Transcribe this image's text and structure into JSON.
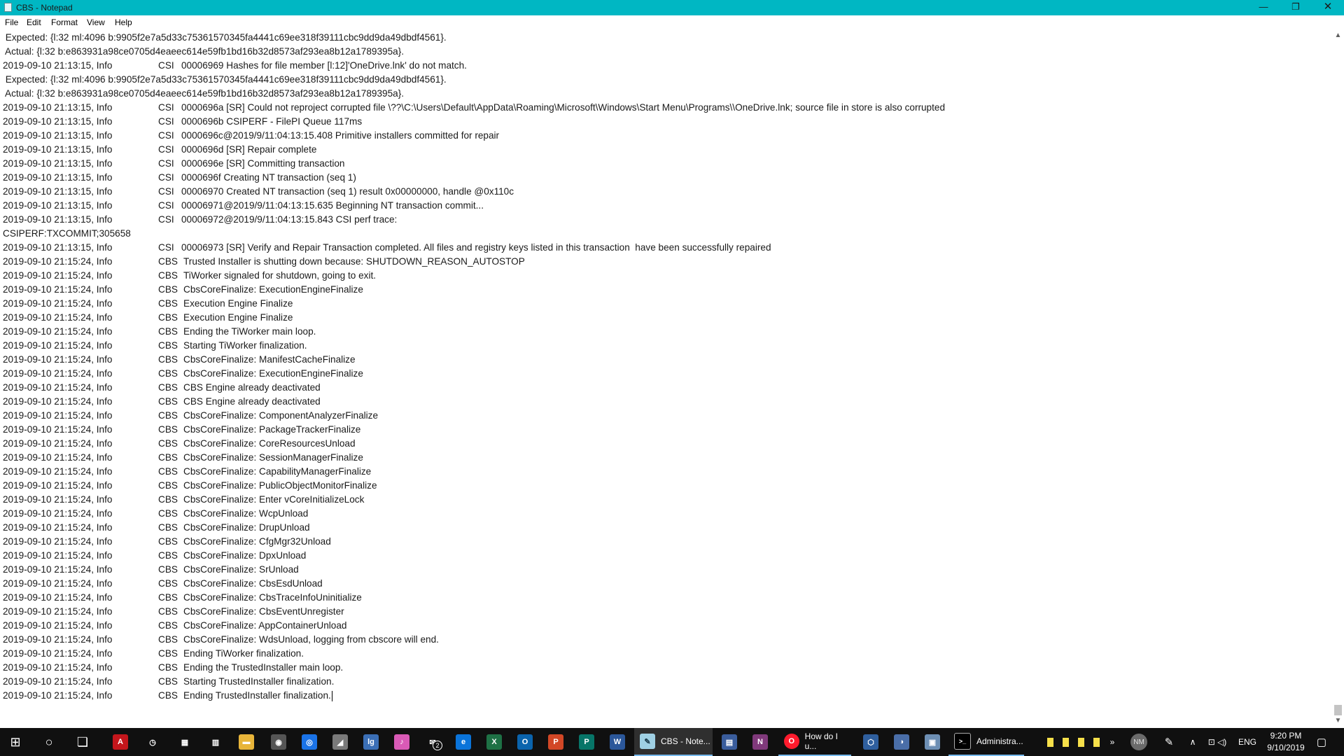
{
  "window": {
    "title": "CBS - Notepad",
    "minimize_glyph": "—",
    "maximize_glyph": "❐",
    "close_glyph": "✕"
  },
  "menu": [
    "File",
    "Edit",
    "Format",
    "View",
    "Help"
  ],
  "log": {
    "raw_lines": [
      " Expected: {l:32 ml:4096 b:9905f2e7a5d33c75361570345fa4441c69ee318f39111cbc9dd9da49dbdf4561}.",
      " Actual: {l:32 b:e863931a98ce0705d4eaeec614e59fb1bd16b32d8573af293ea8b12a1789395a}."
    ],
    "entries": [
      {
        "kind": "raw",
        "text": " Expected: {l:32 ml:4096 b:9905f2e7a5d33c75361570345fa4441c69ee318f39111cbc9dd9da49dbdf4561}."
      },
      {
        "kind": "raw",
        "text": " Actual: {l:32 b:e863931a98ce0705d4eaeec614e59fb1bd16b32d8573af293ea8b12a1789395a}."
      },
      {
        "kind": "entry",
        "ts": "2019-09-10 21:13:15, Info",
        "src": "CSI",
        "msg": "00006969 Hashes for file member [l:12]'OneDrive.lnk' do not match."
      },
      {
        "kind": "raw",
        "text": " Expected: {l:32 ml:4096 b:9905f2e7a5d33c75361570345fa4441c69ee318f39111cbc9dd9da49dbdf4561}."
      },
      {
        "kind": "raw",
        "text": " Actual: {l:32 b:e863931a98ce0705d4eaeec614e59fb1bd16b32d8573af293ea8b12a1789395a}."
      },
      {
        "kind": "entry",
        "ts": "2019-09-10 21:13:15, Info",
        "src": "CSI",
        "msg": "0000696a [SR] Could not reproject corrupted file \\??\\C:\\Users\\Default\\AppData\\Roaming\\Microsoft\\Windows\\Start Menu\\Programs\\\\OneDrive.lnk; source file in store is also corrupted"
      },
      {
        "kind": "entry",
        "ts": "2019-09-10 21:13:15, Info",
        "src": "CSI",
        "msg": "0000696b CSIPERF - FilePI Queue 117ms"
      },
      {
        "kind": "entry",
        "ts": "2019-09-10 21:13:15, Info",
        "src": "CSI",
        "msg": "0000696c@2019/9/11:04:13:15.408 Primitive installers committed for repair"
      },
      {
        "kind": "entry",
        "ts": "2019-09-10 21:13:15, Info",
        "src": "CSI",
        "msg": "0000696d [SR] Repair complete"
      },
      {
        "kind": "entry",
        "ts": "2019-09-10 21:13:15, Info",
        "src": "CSI",
        "msg": "0000696e [SR] Committing transaction"
      },
      {
        "kind": "entry",
        "ts": "2019-09-10 21:13:15, Info",
        "src": "CSI",
        "msg": "0000696f Creating NT transaction (seq 1)"
      },
      {
        "kind": "entry",
        "ts": "2019-09-10 21:13:15, Info",
        "src": "CSI",
        "msg": "00006970 Created NT transaction (seq 1) result 0x00000000, handle @0x110c"
      },
      {
        "kind": "entry",
        "ts": "2019-09-10 21:13:15, Info",
        "src": "CSI",
        "msg": "00006971@2019/9/11:04:13:15.635 Beginning NT transaction commit..."
      },
      {
        "kind": "entry",
        "ts": "2019-09-10 21:13:15, Info",
        "src": "CSI",
        "msg": "00006972@2019/9/11:04:13:15.843 CSI perf trace:"
      },
      {
        "kind": "raw",
        "text": "CSIPERF:TXCOMMIT;305658"
      },
      {
        "kind": "entry",
        "ts": "2019-09-10 21:13:15, Info",
        "src": "CSI",
        "msg": "00006973 [SR] Verify and Repair Transaction completed. All files and registry keys listed in this transaction  have been successfully repaired"
      },
      {
        "kind": "entry",
        "ts": "2019-09-10 21:15:24, Info",
        "src": "CBS",
        "msg": "Trusted Installer is shutting down because: SHUTDOWN_REASON_AUTOSTOP"
      },
      {
        "kind": "entry",
        "ts": "2019-09-10 21:15:24, Info",
        "src": "CBS",
        "msg": "TiWorker signaled for shutdown, going to exit."
      },
      {
        "kind": "entry",
        "ts": "2019-09-10 21:15:24, Info",
        "src": "CBS",
        "msg": "CbsCoreFinalize: ExecutionEngineFinalize"
      },
      {
        "kind": "entry",
        "ts": "2019-09-10 21:15:24, Info",
        "src": "CBS",
        "msg": "Execution Engine Finalize"
      },
      {
        "kind": "entry",
        "ts": "2019-09-10 21:15:24, Info",
        "src": "CBS",
        "msg": "Execution Engine Finalize"
      },
      {
        "kind": "entry",
        "ts": "2019-09-10 21:15:24, Info",
        "src": "CBS",
        "msg": "Ending the TiWorker main loop."
      },
      {
        "kind": "entry",
        "ts": "2019-09-10 21:15:24, Info",
        "src": "CBS",
        "msg": "Starting TiWorker finalization."
      },
      {
        "kind": "entry",
        "ts": "2019-09-10 21:15:24, Info",
        "src": "CBS",
        "msg": "CbsCoreFinalize: ManifestCacheFinalize"
      },
      {
        "kind": "entry",
        "ts": "2019-09-10 21:15:24, Info",
        "src": "CBS",
        "msg": "CbsCoreFinalize: ExecutionEngineFinalize"
      },
      {
        "kind": "entry",
        "ts": "2019-09-10 21:15:24, Info",
        "src": "CBS",
        "msg": "CBS Engine already deactivated"
      },
      {
        "kind": "entry",
        "ts": "2019-09-10 21:15:24, Info",
        "src": "CBS",
        "msg": "CBS Engine already deactivated"
      },
      {
        "kind": "entry",
        "ts": "2019-09-10 21:15:24, Info",
        "src": "CBS",
        "msg": "CbsCoreFinalize: ComponentAnalyzerFinalize"
      },
      {
        "kind": "entry",
        "ts": "2019-09-10 21:15:24, Info",
        "src": "CBS",
        "msg": "CbsCoreFinalize: PackageTrackerFinalize"
      },
      {
        "kind": "entry",
        "ts": "2019-09-10 21:15:24, Info",
        "src": "CBS",
        "msg": "CbsCoreFinalize: CoreResourcesUnload"
      },
      {
        "kind": "entry",
        "ts": "2019-09-10 21:15:24, Info",
        "src": "CBS",
        "msg": "CbsCoreFinalize: SessionManagerFinalize"
      },
      {
        "kind": "entry",
        "ts": "2019-09-10 21:15:24, Info",
        "src": "CBS",
        "msg": "CbsCoreFinalize: CapabilityManagerFinalize"
      },
      {
        "kind": "entry",
        "ts": "2019-09-10 21:15:24, Info",
        "src": "CBS",
        "msg": "CbsCoreFinalize: PublicObjectMonitorFinalize"
      },
      {
        "kind": "entry",
        "ts": "2019-09-10 21:15:24, Info",
        "src": "CBS",
        "msg": "CbsCoreFinalize: Enter vCoreInitializeLock"
      },
      {
        "kind": "entry",
        "ts": "2019-09-10 21:15:24, Info",
        "src": "CBS",
        "msg": "CbsCoreFinalize: WcpUnload"
      },
      {
        "kind": "entry",
        "ts": "2019-09-10 21:15:24, Info",
        "src": "CBS",
        "msg": "CbsCoreFinalize: DrupUnload"
      },
      {
        "kind": "entry",
        "ts": "2019-09-10 21:15:24, Info",
        "src": "CBS",
        "msg": "CbsCoreFinalize: CfgMgr32Unload"
      },
      {
        "kind": "entry",
        "ts": "2019-09-10 21:15:24, Info",
        "src": "CBS",
        "msg": "CbsCoreFinalize: DpxUnload"
      },
      {
        "kind": "entry",
        "ts": "2019-09-10 21:15:24, Info",
        "src": "CBS",
        "msg": "CbsCoreFinalize: SrUnload"
      },
      {
        "kind": "entry",
        "ts": "2019-09-10 21:15:24, Info",
        "src": "CBS",
        "msg": "CbsCoreFinalize: CbsEsdUnload"
      },
      {
        "kind": "entry",
        "ts": "2019-09-10 21:15:24, Info",
        "src": "CBS",
        "msg": "CbsCoreFinalize: CbsTraceInfoUninitialize"
      },
      {
        "kind": "entry",
        "ts": "2019-09-10 21:15:24, Info",
        "src": "CBS",
        "msg": "CbsCoreFinalize: CbsEventUnregister"
      },
      {
        "kind": "entry",
        "ts": "2019-09-10 21:15:24, Info",
        "src": "CBS",
        "msg": "CbsCoreFinalize: AppContainerUnload"
      },
      {
        "kind": "entry",
        "ts": "2019-09-10 21:15:24, Info",
        "src": "CBS",
        "msg": "CbsCoreFinalize: WdsUnload, logging from cbscore will end."
      },
      {
        "kind": "entry",
        "ts": "2019-09-10 21:15:24, Info",
        "src": "CBS",
        "msg": "Ending TiWorker finalization."
      },
      {
        "kind": "entry",
        "ts": "2019-09-10 21:15:24, Info",
        "src": "CBS",
        "msg": "Ending the TrustedInstaller main loop."
      },
      {
        "kind": "entry",
        "ts": "2019-09-10 21:15:24, Info",
        "src": "CBS",
        "msg": "Starting TrustedInstaller finalization."
      },
      {
        "kind": "entry",
        "ts": "2019-09-10 21:15:24, Info",
        "src": "CBS",
        "msg": "Ending TrustedInstaller finalization.",
        "caret": true
      }
    ]
  },
  "scrollbar": {
    "up_glyph": "▲",
    "down_glyph": "▼",
    "position": 0.99
  },
  "taskbar": {
    "pinned": [
      {
        "name": "start-icon",
        "glyph": "⊞",
        "color": "#101010"
      },
      {
        "name": "search-icon",
        "glyph": "○",
        "color": "#101010"
      },
      {
        "name": "task-view-icon",
        "glyph": "❏",
        "color": "#101010"
      },
      {
        "name": "acrobat-icon",
        "glyph": "A",
        "color": "#c4161c"
      },
      {
        "name": "alarms-icon",
        "glyph": "◷",
        "color": "#101010"
      },
      {
        "name": "calculator-icon",
        "glyph": "▦",
        "color": "#101010"
      },
      {
        "name": "calendar-icon",
        "glyph": "▥",
        "color": "#101010"
      },
      {
        "name": "file-explorer-icon",
        "glyph": "▬",
        "color": "#e8b53a"
      },
      {
        "name": "app-icon-1",
        "glyph": "◉",
        "color": "#555555"
      },
      {
        "name": "chrome-icon",
        "glyph": "◎",
        "color": "#1a73e8"
      },
      {
        "name": "app-icon-2",
        "glyph": "◢",
        "color": "#7a7a7a"
      },
      {
        "name": "app-icon-3",
        "glyph": "lg",
        "color": "#3b6fb6"
      },
      {
        "name": "itunes-icon",
        "glyph": "♪",
        "color": "#d95ab6"
      },
      {
        "name": "mail-icon",
        "glyph": "✉",
        "color": "#101010"
      },
      {
        "name": "edge-icon",
        "glyph": "e",
        "color": "#0a74da"
      },
      {
        "name": "excel-icon",
        "glyph": "X",
        "color": "#1e7145"
      },
      {
        "name": "outlook-icon",
        "glyph": "O",
        "color": "#0a64ad"
      },
      {
        "name": "powerpoint-icon",
        "glyph": "P",
        "color": "#d24726"
      },
      {
        "name": "publisher-icon",
        "glyph": "P",
        "color": "#077568"
      },
      {
        "name": "word-icon",
        "glyph": "W",
        "color": "#2b579a"
      }
    ],
    "mail_badge": "2",
    "notepad_label": "CBS - Note...",
    "opera_label": "How do I u...",
    "cmd_label": "Administra...",
    "mid_icons": [
      {
        "name": "app-icon-4",
        "glyph": "▤",
        "color": "#3a5d9c"
      },
      {
        "name": "onenote-icon",
        "glyph": "N",
        "color": "#80397b"
      }
    ],
    "after_opera_icons": [
      {
        "name": "virtualbox-icon",
        "glyph": "⬡",
        "color": "#2f5f9e"
      },
      {
        "name": "app-icon-5",
        "glyph": "◑",
        "color": "#4a6ea8"
      },
      {
        "name": "app-icon-6",
        "glyph": "▣",
        "color": "#6d8fb4"
      }
    ],
    "overflow_glyph": "»",
    "avatar_initials": "NM",
    "tray_pen_glyph": "✎",
    "tray_chevron_glyph": "∧",
    "tray_icons_glyph": "⊡ ◁)",
    "language": "ENG",
    "time": "9:20 PM",
    "date": "9/10/2019",
    "notifications_glyph": "▢"
  }
}
